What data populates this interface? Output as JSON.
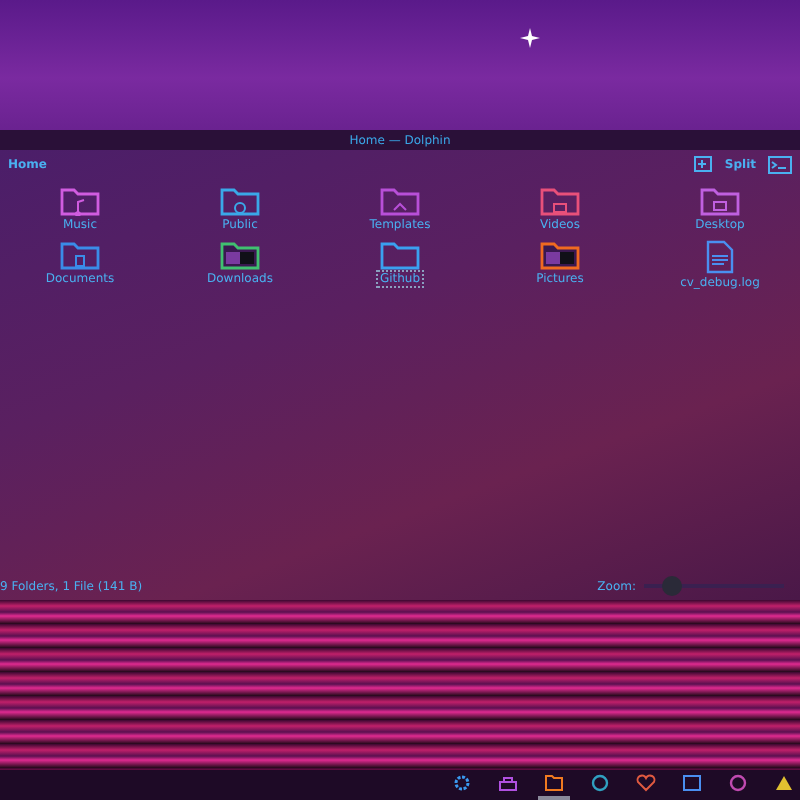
{
  "window": {
    "title": "Home — Dolphin"
  },
  "toolbar": {
    "location": "Home",
    "split_label": "Split"
  },
  "items": [
    {
      "name": "Music",
      "kind": "music",
      "color": "#d05ce0",
      "selected": false
    },
    {
      "name": "Public",
      "kind": "cloud",
      "color": "#3aa8e8",
      "selected": false
    },
    {
      "name": "Templates",
      "kind": "template",
      "color": "#b84fd8",
      "selected": false
    },
    {
      "name": "Videos",
      "kind": "video",
      "color": "#e8507a",
      "selected": false
    },
    {
      "name": "Desktop",
      "kind": "desktop",
      "color": "#c060e0",
      "selected": false
    },
    {
      "name": "Documents",
      "kind": "document",
      "color": "#3a8ce8",
      "selected": false
    },
    {
      "name": "Downloads",
      "kind": "thumbnails",
      "color": "#40c070",
      "selected": false
    },
    {
      "name": "Github",
      "kind": "folder",
      "color": "#3aa0f0",
      "selected": true
    },
    {
      "name": "Pictures",
      "kind": "thumbnails",
      "color": "#f06a20",
      "selected": false
    },
    {
      "name": "cv_debug.log",
      "kind": "file",
      "color": "#4a8ff0",
      "selected": false
    }
  ],
  "status_bar": {
    "summary": "9 Folders, 1 File (141 B)",
    "zoom_label": "Zoom:",
    "zoom": {
      "level": 0.2
    }
  },
  "taskbar": [
    {
      "kind": "gear",
      "color": "#3a9af0",
      "active": false
    },
    {
      "kind": "bag",
      "color": "#b050e0",
      "active": false
    },
    {
      "kind": "folder",
      "color": "#f07a20",
      "active": true
    },
    {
      "kind": "ring",
      "color": "#30a0c0",
      "active": false
    },
    {
      "kind": "heart",
      "color": "#e05a40",
      "active": false
    },
    {
      "kind": "window",
      "color": "#4a8ff0",
      "active": false
    },
    {
      "kind": "ring",
      "color": "#c04ab0",
      "active": false
    },
    {
      "kind": "triangle",
      "color": "#e0c030",
      "active": false
    }
  ]
}
